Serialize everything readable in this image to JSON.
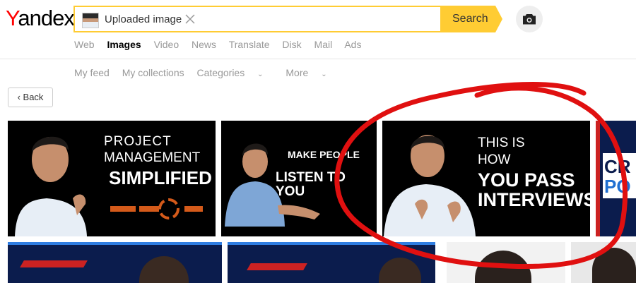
{
  "logo": {
    "y": "Y",
    "rest": "andex"
  },
  "search": {
    "thumb_icon": "image-thumbnail",
    "value": "Uploaded image",
    "clear_icon": "close-icon",
    "button_label": "Search",
    "camera_icon": "camera-icon"
  },
  "nav": {
    "items": [
      "Web",
      "Images",
      "Video",
      "News",
      "Translate",
      "Disk",
      "Mail",
      "Ads"
    ],
    "active": "Images"
  },
  "subnav": {
    "items": [
      "My feed",
      "My collections",
      "Categories",
      "More"
    ]
  },
  "back": {
    "label": "Back"
  },
  "results": {
    "t1": {
      "line1": "PROJECT",
      "line2": "MANAGEMENT",
      "line3": "SIMPLIFIED"
    },
    "t2": {
      "line1": "MAKE PEOPLE",
      "line2": "LISTEN TO YOU"
    },
    "t3": {
      "line1": "THIS IS",
      "line2": "HOW",
      "line3": "YOU PASS",
      "line4": "INTERVIEWS"
    },
    "t4": {
      "line1": "CR",
      "line2": "PO"
    }
  },
  "colors": {
    "accent": "#fc3",
    "logo_red": "#f00",
    "annotation": "#e01010",
    "tile_bg": "#000000",
    "tile_blue": "#0b1c4d"
  }
}
